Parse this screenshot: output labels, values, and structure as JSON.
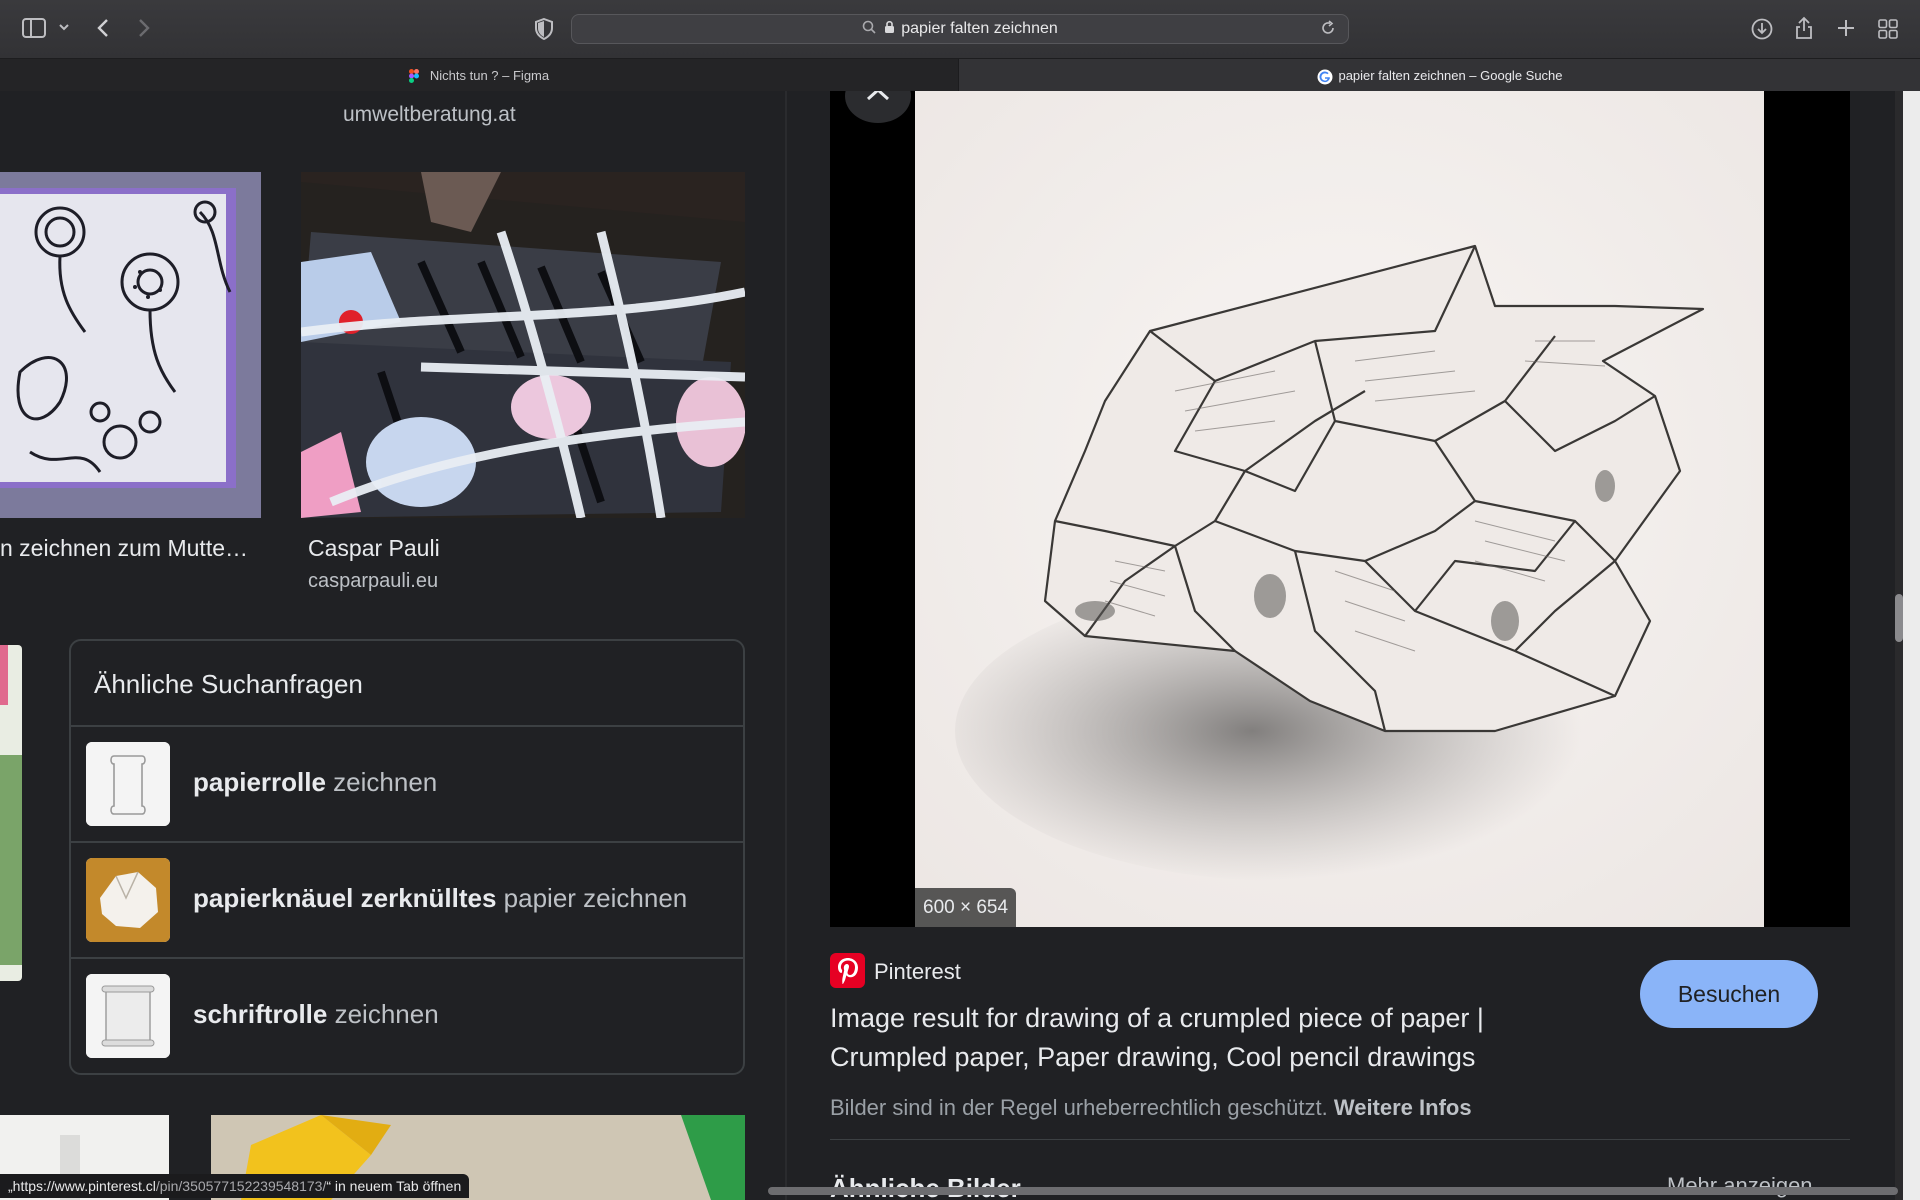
{
  "browser": {
    "address": "papier falten zeichnen",
    "tabs": [
      {
        "label": "Nichts tun ? – Figma",
        "active": false
      },
      {
        "label": "papier falten zeichnen – Google Suche",
        "active": true
      }
    ]
  },
  "results": {
    "top_source": "umweltberatung.at",
    "items": [
      {
        "title": "n zeichnen zum Mutte…",
        "source": ""
      },
      {
        "title": "Caspar Pauli",
        "source": "casparpauli.eu"
      }
    ],
    "related": {
      "heading": "Ähnliche Suchanfragen",
      "rows": [
        {
          "bold": "papierrolle",
          "rest": " zeichnen"
        },
        {
          "bold": "papierknäuel zerknülltes",
          "rest": " papier zeichnen"
        },
        {
          "bold": "schriftrolle",
          "rest": " zeichnen"
        }
      ]
    }
  },
  "status": {
    "prefix": "„https://www.pinterest.cl",
    "path": "/pin/350577152239548173/",
    "suffix": "“ in neuem Tab öffnen"
  },
  "preview": {
    "size_badge": "600 × 654",
    "source_name": "Pinterest",
    "title": "Image result for drawing of a crumpled piece of paper | Crumpled paper, Paper drawing, Cool pencil drawings",
    "copyright_text": "Bilder sind in der Regel urheberrechtlich geschützt.",
    "copyright_link": "Weitere Infos",
    "visit_label": "Besuchen",
    "similar_heading": "Ähnliche Bilder",
    "more_label": "Mehr anzeigen"
  },
  "colors": {
    "background": "#202124",
    "accent_button": "#8ab4f8",
    "pinterest_red": "#e60023"
  }
}
